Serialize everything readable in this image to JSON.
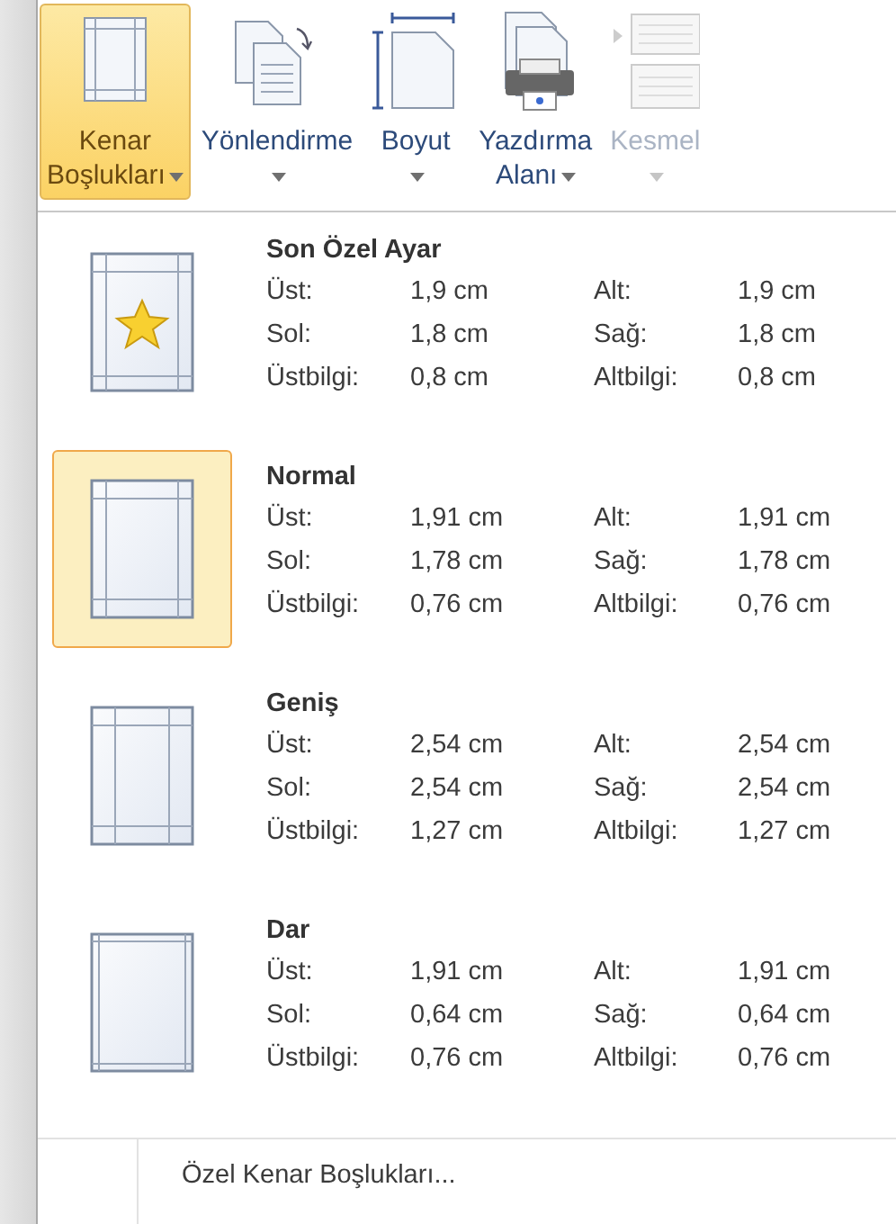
{
  "ribbon": {
    "buttons": [
      {
        "kind": "margins",
        "lines": [
          "Kenar",
          "Boşlukları"
        ],
        "dropdown": true,
        "selected": true,
        "disabled": false
      },
      {
        "kind": "orientation",
        "lines": [
          "Yönlendirme"
        ],
        "dropdown": true,
        "selected": false,
        "disabled": false
      },
      {
        "kind": "size",
        "lines": [
          "Boyut"
        ],
        "dropdown": true,
        "selected": false,
        "disabled": false
      },
      {
        "kind": "print_area",
        "lines": [
          "Yazdırma",
          "Alanı"
        ],
        "dropdown": true,
        "selected": false,
        "disabled": false
      },
      {
        "kind": "breaks",
        "lines": [
          "Kesmel"
        ],
        "dropdown": true,
        "selected": false,
        "disabled": true
      }
    ]
  },
  "margin_presets": [
    {
      "kind": "star",
      "title": "Son Özel Ayar",
      "selected": false,
      "rows": [
        {
          "label": "Üst:",
          "value": "1,9 cm",
          "label_2": "Alt:",
          "value_2": "1,9 cm"
        },
        {
          "label": "Sol:",
          "value": "1,8 cm",
          "label_2": "Sağ:",
          "value_2": "1,8 cm"
        },
        {
          "label": "Üstbilgi:",
          "value": "0,8 cm",
          "label_2": "Altbilgi:",
          "value_2": "0,8 cm"
        }
      ]
    },
    {
      "kind": "normal",
      "title": "Normal",
      "selected": true,
      "rows": [
        {
          "label": "Üst:",
          "value": "1,91 cm",
          "label_2": "Alt:",
          "value_2": "1,91 cm"
        },
        {
          "label": "Sol:",
          "value": "1,78 cm",
          "label_2": "Sağ:",
          "value_2": "1,78 cm"
        },
        {
          "label": "Üstbilgi:",
          "value": "0,76 cm",
          "label_2": "Altbilgi:",
          "value_2": "0,76 cm"
        }
      ]
    },
    {
      "kind": "wide",
      "title": "Geniş",
      "selected": false,
      "rows": [
        {
          "label": "Üst:",
          "value": "2,54 cm",
          "label_2": "Alt:",
          "value_2": "2,54 cm"
        },
        {
          "label": "Sol:",
          "value": "2,54 cm",
          "label_2": "Sağ:",
          "value_2": "2,54 cm"
        },
        {
          "label": "Üstbilgi:",
          "value": "1,27 cm",
          "label_2": "Altbilgi:",
          "value_2": "1,27 cm"
        }
      ]
    },
    {
      "kind": "narrow",
      "title": "Dar",
      "selected": false,
      "rows": [
        {
          "label": "Üst:",
          "value": "1,91 cm",
          "label_2": "Alt:",
          "value_2": "1,91 cm"
        },
        {
          "label": "Sol:",
          "value": "0,64 cm",
          "label_2": "Sağ:",
          "value_2": "0,64 cm"
        },
        {
          "label": "Üstbilgi:",
          "value": "0,76 cm",
          "label_2": "Altbilgi:",
          "value_2": "0,76 cm"
        }
      ]
    }
  ],
  "footer_item": {
    "label": "Özel Kenar Boşlukları..."
  }
}
